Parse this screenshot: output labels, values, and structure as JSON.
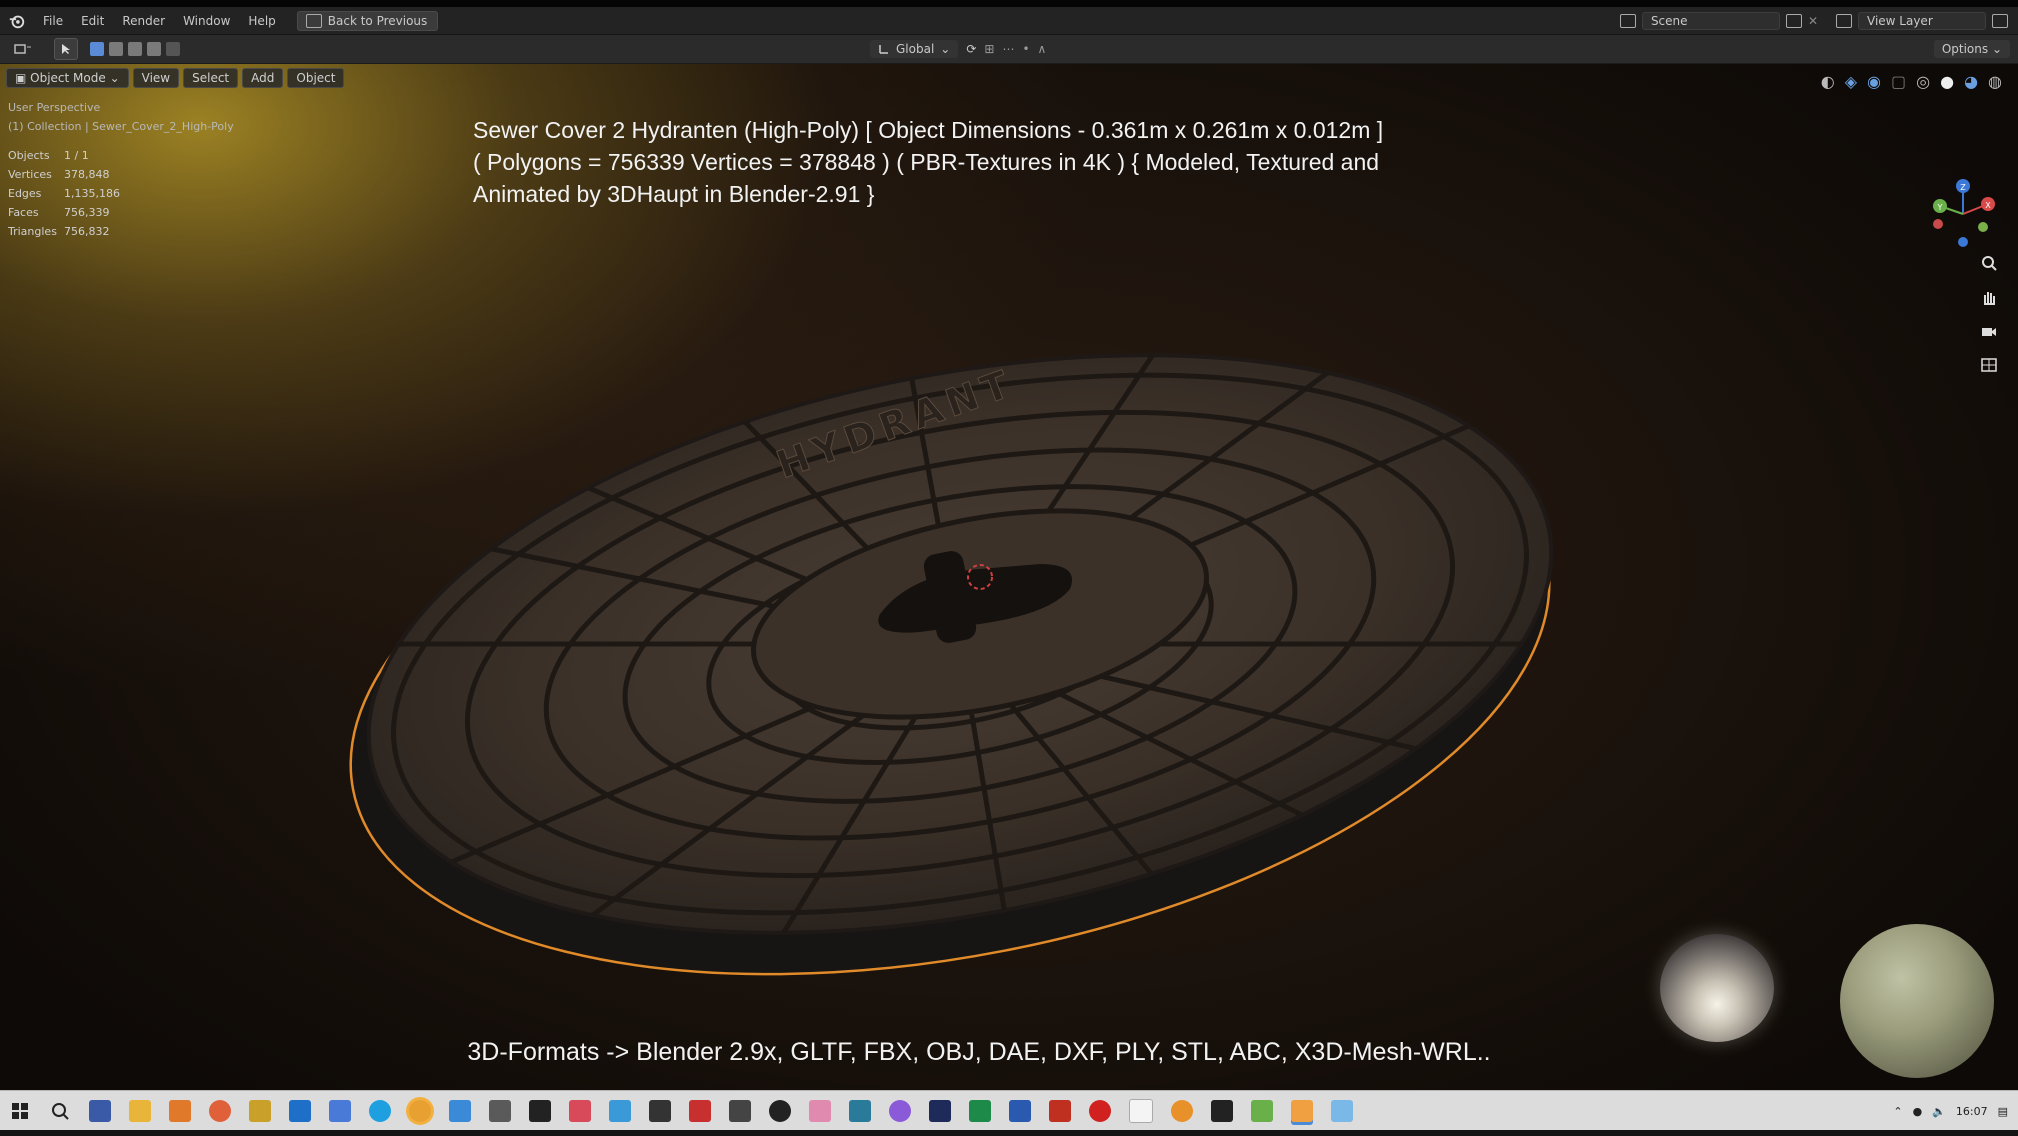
{
  "menubar": {
    "items": [
      "File",
      "Edit",
      "Render",
      "Window",
      "Help"
    ],
    "back_button": "Back to Previous",
    "scene_label": "Scene",
    "view_layer_label": "View Layer"
  },
  "toolbar": {
    "orientation": "Global",
    "options_label": "Options"
  },
  "viewport": {
    "mode": "Object Mode",
    "menus": [
      "View",
      "Select",
      "Add",
      "Object"
    ],
    "perspective": "User Perspective",
    "collection": "(1) Collection | Sewer_Cover_2_High-Poly",
    "stats": [
      {
        "label": "Objects",
        "value": "1 / 1"
      },
      {
        "label": "Vertices",
        "value": "378,848"
      },
      {
        "label": "Edges",
        "value": "1,135,186"
      },
      {
        "label": "Faces",
        "value": "756,339"
      },
      {
        "label": "Triangles",
        "value": "756,832"
      }
    ],
    "gizmo_axes": {
      "x": "X",
      "y": "Y",
      "z": "Z"
    }
  },
  "overlay": {
    "title_line1": "Sewer Cover 2 Hydranten (High-Poly) [ Object Dimensions -  0.361m x 0.261m x 0.012m ]",
    "title_line2": "( Polygons = 756339 Vertices = 378848 ) ( PBR-Textures in 4K ) { Modeled, Textured and",
    "title_line3": "Animated by 3DHaupt in Blender-2.91 }",
    "formats": "3D-Formats -> Blender 2.9x, GLTF, FBX, OBJ, DAE, DXF, PLY, STL, ABC, X3D-Mesh-WRL.."
  },
  "model": {
    "embossed_text": "HYDRANT",
    "outline_color": "#e08a2a"
  },
  "taskbar": {
    "clock": "16:07"
  },
  "colors": {
    "menubar_bg": "#232323",
    "toolbar_bg": "#2b2b2b",
    "taskbar_bg": "#dcdcdc",
    "selection_outline": "#e08a2a"
  }
}
